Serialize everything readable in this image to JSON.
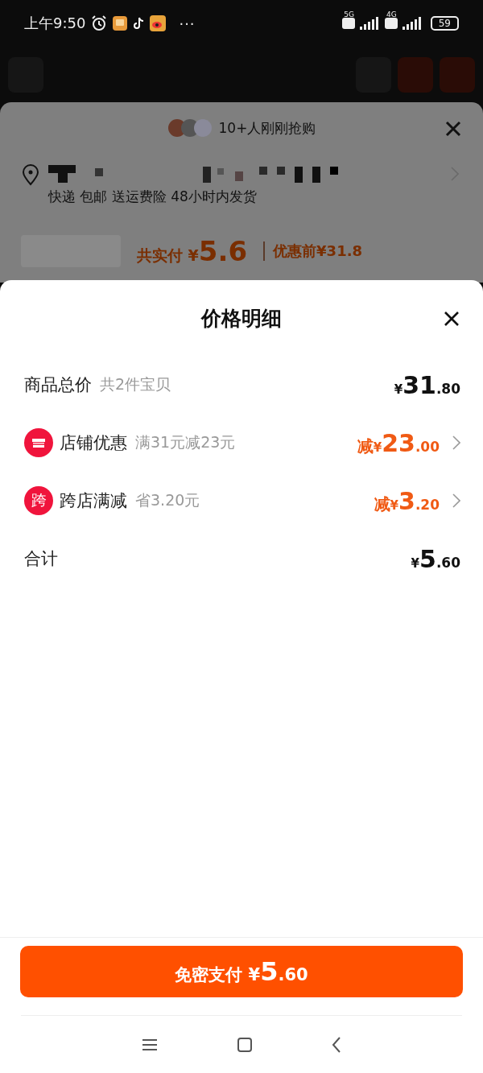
{
  "status_bar": {
    "time": "上午9:50",
    "more": "···",
    "battery": "59",
    "net_labels": [
      "5G",
      "4G"
    ]
  },
  "background_sheet": {
    "buyers_text": "10+人刚刚抢购",
    "shipping": "快递 包邮 送运费险 48小时内发货",
    "price_label": "共实付",
    "price_currency": "¥",
    "price_value": "5.6",
    "original_price": "优惠前¥31.8"
  },
  "price_sheet": {
    "title": "价格明细",
    "rows": [
      {
        "kind": "plain",
        "label": "商品总价",
        "note": "共2件宝贝",
        "amount": {
          "currency": "¥",
          "integer": "31",
          "decimal": ".80"
        }
      },
      {
        "kind": "discount",
        "badge": {
          "kind": "store"
        },
        "label": "店铺优惠",
        "note": "满31元减23元",
        "amount": {
          "prefix": "减",
          "currency": "¥",
          "integer": "23",
          "decimal": ".00"
        }
      },
      {
        "kind": "discount",
        "badge": {
          "kind": "glyph",
          "text": "跨"
        },
        "label": "跨店满减",
        "note": "省3.20元",
        "amount": {
          "prefix": "减",
          "currency": "¥",
          "integer": "3",
          "decimal": ".20"
        }
      },
      {
        "kind": "plain",
        "label": "合计",
        "amount": {
          "currency": "¥",
          "integer": "5",
          "decimal": ".60"
        }
      }
    ],
    "pay_button": {
      "label": "免密支付",
      "currency": "¥",
      "integer": "5",
      "decimal": ".60"
    }
  }
}
